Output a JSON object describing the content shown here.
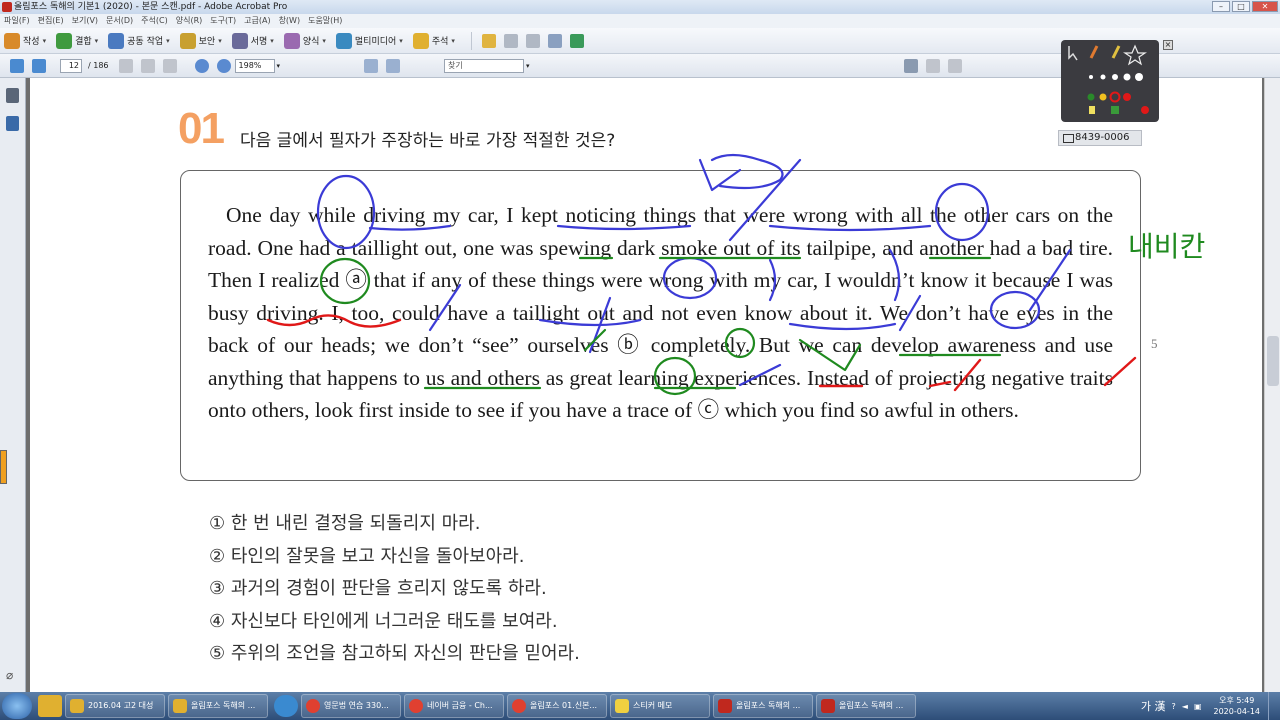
{
  "window": {
    "title": "올림포스 독해의 기본1 (2020) - 본문 스캔.pdf - Adobe Acrobat Pro"
  },
  "menu": [
    "파일(F)",
    "편집(E)",
    "보기(V)",
    "문서(D)",
    "주석(C)",
    "양식(R)",
    "도구(T)",
    "고급(A)",
    "창(W)",
    "도움말(H)"
  ],
  "toolbar": {
    "create": "작성",
    "combine": "결합",
    "collaborate": "공동 작업",
    "secure": "보안",
    "sign": "서명",
    "forms": "양식",
    "multimedia": "멀티미디어",
    "comment": "주석"
  },
  "nav": {
    "page": "12",
    "total": "/ 186",
    "zoom": "198%",
    "find": "찾기"
  },
  "question": {
    "number": "01",
    "title": "다음 글에서 필자가 주장하는 바로 가장 적절한 것은?",
    "code": "8439-0006",
    "passage": "One day while driving my car, I kept noticing things that were wrong with all the other cars on the road. One had a taillight out, one was spewing dark smoke out of its tailpipe, and another had a bad tire. Then I realized ⓐ that if any of these things were wrong with my car, I wouldn’t know it because I was busy driving. I, too, could have a taillight out and not even know about it. We don’t have eyes in the back of our heads; we don’t “see” ourselves ⓑ completely. But we can develop awareness and use anything that happens to us and others as great learning experiences. Instead of projecting negative traits onto others, look first inside to see if you have a trace of ⓒ which you find so awful in others.",
    "line_number": "5",
    "options": [
      "① 한 번 내린 결정을 되돌리지 마라.",
      "② 타인의 잘못을 보고 자신을 돌아보아라.",
      "③ 과거의 경험이 판단을 흐리지 않도록 하라.",
      "④ 자신보다 타인에게 너그러운 태도를 보여라.",
      "⑤ 주위의 조언을 참고하되 자신의 판단을 믿어라."
    ],
    "handwriting": "내비칸"
  },
  "taskbar": {
    "items": [
      "2016.04 고2 대성",
      "올림포스 독해의 ...",
      "영문법 연습 330...",
      "네이버 금융 - Ch...",
      "올림포스 01.신본...",
      "스티커 메모",
      "올림포스 독해의 ...",
      "올림포스 독해의 ..."
    ],
    "ime": "가 漢",
    "time": "오후 5:49",
    "date": "2020-04-14"
  },
  "colors": {
    "annot_blue": "#3b3bd6",
    "annot_green": "#1f8a1f",
    "annot_red": "#e01818",
    "qnum": "#f4a062"
  }
}
